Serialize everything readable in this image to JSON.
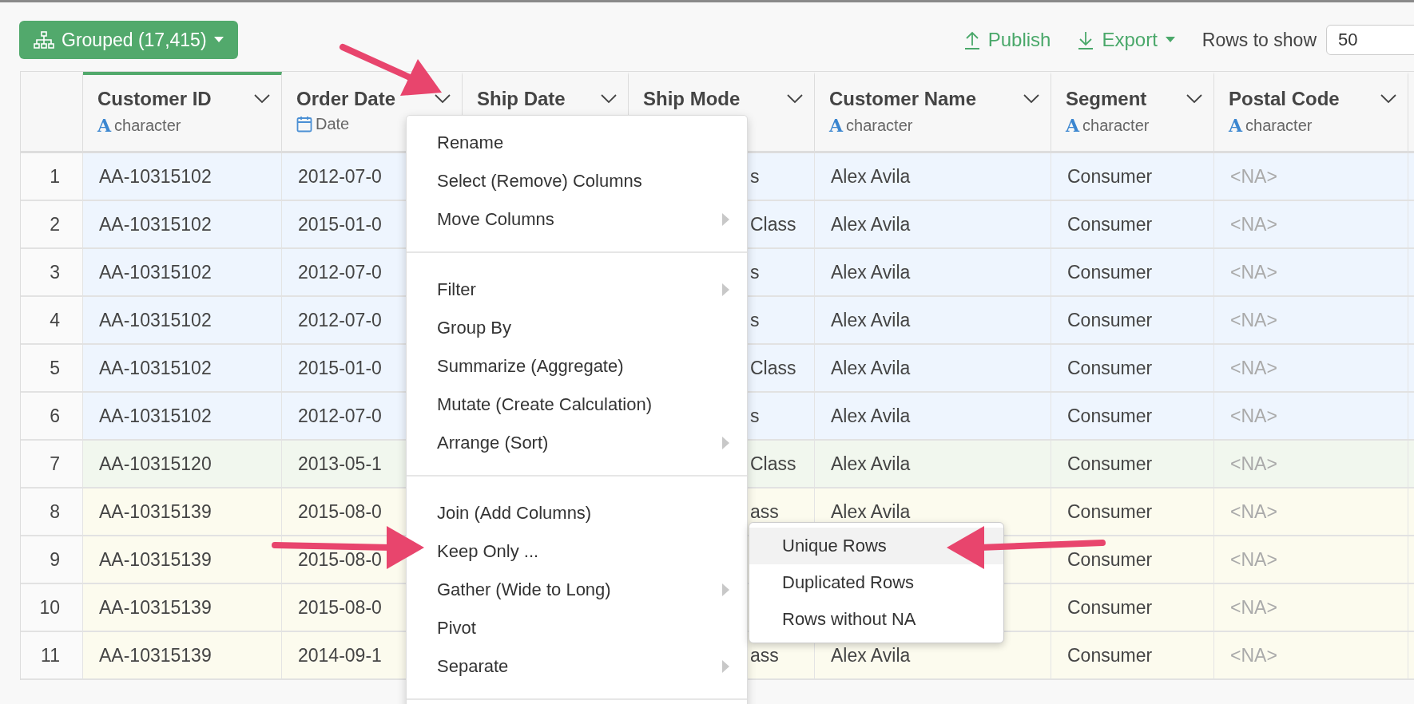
{
  "toolbar": {
    "grouped_button": {
      "label": "Grouped (17,415)"
    },
    "actions": [
      {
        "kind": "publish",
        "label": "Publish"
      },
      {
        "kind": "export",
        "label": "Export"
      }
    ],
    "rows_to_show": {
      "label": "Rows to show",
      "value": "50"
    }
  },
  "table": {
    "columns": [
      {
        "name": "Customer ID",
        "grouped": true,
        "icon": "A",
        "type_label": "character"
      },
      {
        "name": "Order Date",
        "grouped": false,
        "type_label": "Date"
      },
      {
        "name": "Ship Date",
        "grouped": false
      },
      {
        "name": "Ship Mode",
        "grouped": false
      },
      {
        "name": "Customer Name",
        "grouped": false,
        "icon": "A",
        "type_label": "character"
      },
      {
        "name": "Segment",
        "grouped": false,
        "icon": "A",
        "type_label": "character"
      },
      {
        "name": "Postal Code",
        "grouped": false,
        "icon": "A",
        "type_label": "character"
      }
    ],
    "rows": [
      {
        "number": "1",
        "color": "#eef5fe",
        "customer_id": "AA-10315102",
        "order_date": "2012-07-0",
        "ship_mode": "s",
        "customer_name": "Alex Avila",
        "segment": "Consumer",
        "postal_code": "<NA>",
        "postal_missing": true
      },
      {
        "number": "2",
        "color": "#eef5fe",
        "customer_id": "AA-10315102",
        "order_date": "2015-01-0",
        "ship_mode": "Class",
        "customer_name": "Alex Avila",
        "segment": "Consumer",
        "postal_code": "<NA>",
        "postal_missing": true
      },
      {
        "number": "3",
        "color": "#eef5fe",
        "customer_id": "AA-10315102",
        "order_date": "2012-07-0",
        "ship_mode": "s",
        "customer_name": "Alex Avila",
        "segment": "Consumer",
        "postal_code": "<NA>",
        "postal_missing": true
      },
      {
        "number": "4",
        "color": "#eef5fe",
        "customer_id": "AA-10315102",
        "order_date": "2012-07-0",
        "ship_mode": "s",
        "customer_name": "Alex Avila",
        "segment": "Consumer",
        "postal_code": "<NA>",
        "postal_missing": true
      },
      {
        "number": "5",
        "color": "#eef5fe",
        "customer_id": "AA-10315102",
        "order_date": "2015-01-0",
        "ship_mode": "Class",
        "customer_name": "Alex Avila",
        "segment": "Consumer",
        "postal_code": "<NA>",
        "postal_missing": true
      },
      {
        "number": "6",
        "color": "#eef5fe",
        "customer_id": "AA-10315102",
        "order_date": "2012-07-0",
        "ship_mode": "s",
        "customer_name": "Alex Avila",
        "segment": "Consumer",
        "postal_code": "<NA>",
        "postal_missing": true
      },
      {
        "number": "7",
        "color": "#f1f7ee",
        "customer_id": "AA-10315120",
        "order_date": "2013-05-1",
        "ship_mode": "Class",
        "customer_name": "Alex Avila",
        "segment": "Consumer",
        "postal_code": "<NA>",
        "postal_missing": true
      },
      {
        "number": "8",
        "color": "#fcfbee",
        "customer_id": "AA-10315139",
        "order_date": "2015-08-0",
        "ship_mode": "ass",
        "customer_name": "Alex Avila",
        "segment": "Consumer",
        "postal_code": "<NA>",
        "postal_missing": true
      },
      {
        "number": "9",
        "color": "#fcfbee",
        "customer_id": "AA-10315139",
        "order_date": "2015-08-0",
        "segment": "Consumer",
        "postal_code": "<NA>",
        "postal_missing": true
      },
      {
        "number": "10",
        "color": "#fcfbee",
        "customer_id": "AA-10315139",
        "order_date": "2015-08-0",
        "segment": "Consumer",
        "postal_code": "<NA>",
        "postal_missing": true
      },
      {
        "number": "11",
        "color": "#fcfbee",
        "customer_id": "AA-10315139",
        "order_date": "2014-09-1",
        "ship_mode": "ass",
        "customer_name": "Alex Avila",
        "segment": "Consumer",
        "postal_code": "<NA>",
        "postal_missing": true
      }
    ]
  },
  "column_menu": {
    "sections": [
      [
        {
          "label": "Rename",
          "submenu": false
        },
        {
          "label": "Select (Remove) Columns",
          "submenu": false
        },
        {
          "label": "Move Columns",
          "submenu": true
        }
      ],
      [
        {
          "label": "Filter",
          "submenu": true
        },
        {
          "label": "Group By",
          "submenu": false
        },
        {
          "label": "Summarize (Aggregate)",
          "submenu": false
        },
        {
          "label": "Mutate (Create Calculation)",
          "submenu": false
        },
        {
          "label": "Arrange (Sort)",
          "submenu": true
        }
      ],
      [
        {
          "label": "Join (Add Columns)",
          "submenu": false
        },
        {
          "label": "Keep Only ...",
          "submenu": false
        },
        {
          "label": "Gather (Wide to Long)",
          "submenu": true
        },
        {
          "label": "Pivot",
          "submenu": false
        },
        {
          "label": "Separate",
          "submenu": true
        }
      ]
    ]
  },
  "submenu": {
    "items": [
      {
        "label": "Unique Rows",
        "selected": true
      },
      {
        "label": "Duplicated Rows",
        "selected": false
      },
      {
        "label": "Rows without NA",
        "selected": false
      }
    ]
  }
}
